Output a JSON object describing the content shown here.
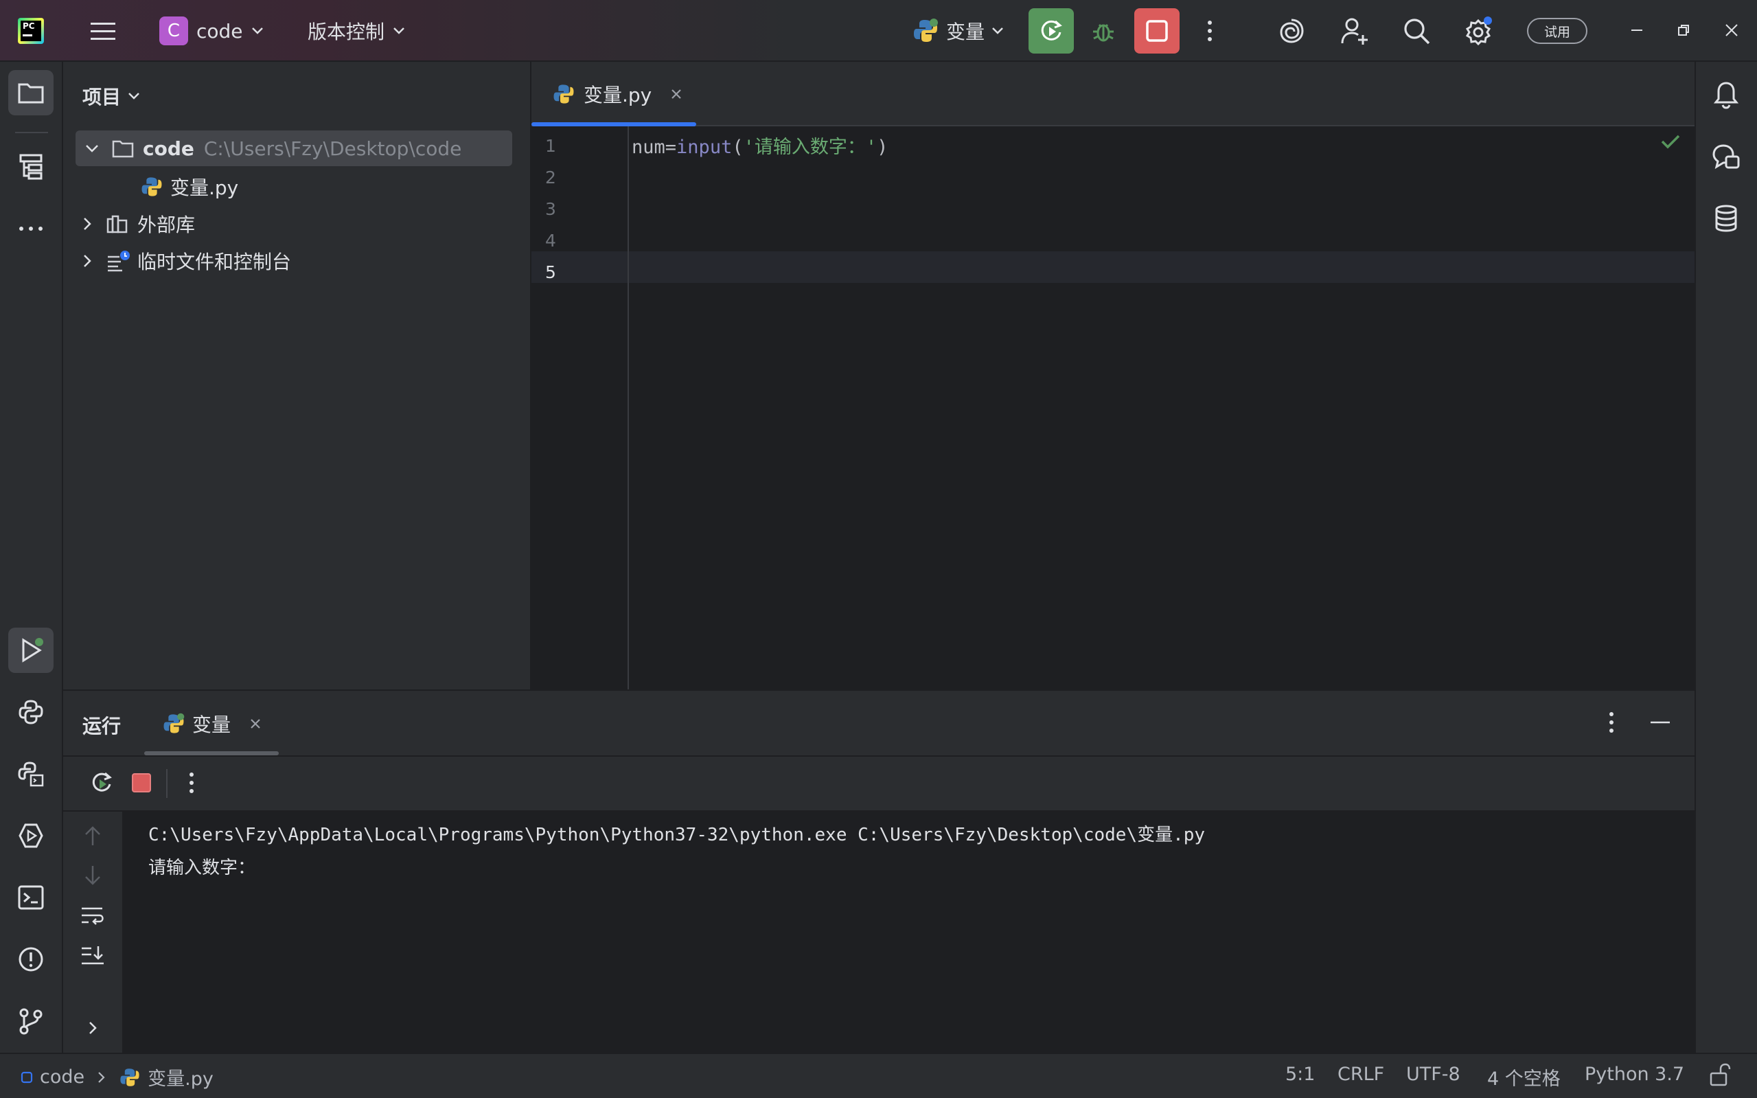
{
  "titlebar": {
    "project_badge": "C",
    "project_name": "code",
    "vcs_label": "版本控制",
    "run_config": "变量",
    "trial_label": "试用",
    "icons": {
      "logo": "pycharm-logo-icon",
      "menu": "hamburger-menu-icon",
      "run": "rerun-icon",
      "debug": "bug-icon",
      "stop": "stop-icon",
      "more": "vertical-dots-icon",
      "ai": "ai-assistant-icon",
      "add_user": "add-user-icon",
      "search": "search-icon",
      "settings": "gear-icon"
    }
  },
  "project_panel": {
    "title": "项目",
    "root": {
      "name": "code",
      "path": "C:\\Users\\Fzy\\Desktop\\code"
    },
    "files": [
      "变量.py"
    ],
    "external_libs": "外部库",
    "scratches": "临时文件和控制台"
  },
  "editor": {
    "tab": "变量.py",
    "line_numbers": [
      "1",
      "2",
      "3",
      "4",
      "5"
    ],
    "code": {
      "var": "num",
      "op": "=",
      "fn": "input",
      "open": "(",
      "str": "'请输入数字：'",
      "close": ")"
    }
  },
  "run_panel": {
    "title": "运行",
    "tab": "变量",
    "command": "C:\\Users\\Fzy\\AppData\\Local\\Programs\\Python\\Python37-32\\python.exe C:\\Users\\Fzy\\Desktop\\code\\变量.py",
    "prompt": "请输入数字："
  },
  "statusbar": {
    "breadcrumb_project": "code",
    "breadcrumb_file": "变量.py",
    "position": "5:1",
    "line_ending": "CRLF",
    "encoding": "UTF-8",
    "indent": "4 个空格",
    "interpreter": "Python 3.7"
  },
  "colors": {
    "accent": "#3574f0",
    "run_green": "#57965c",
    "stop_red": "#db5c5c",
    "project_badge": "#b45bcf",
    "string": "#6aab73",
    "builtin": "#8888c6"
  }
}
